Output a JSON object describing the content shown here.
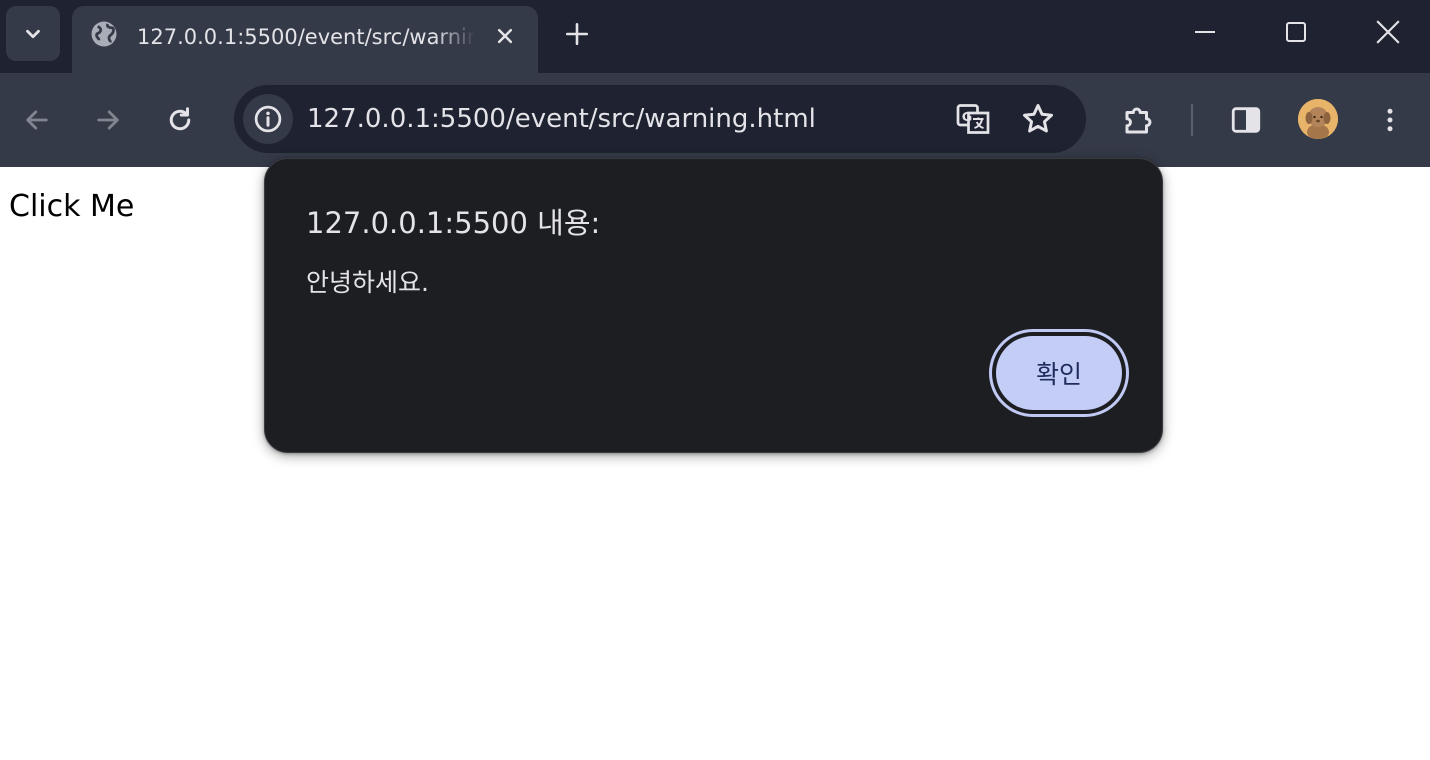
{
  "browser": {
    "tab": {
      "title": "127.0.0.1:5500/event/src/warning.html"
    },
    "address_bar": {
      "url": "127.0.0.1:5500/event/src/warning.html"
    },
    "colors": {
      "tabstrip": "#1f2230",
      "toolbar": "#353a48",
      "accent": "#c4cdf6"
    }
  },
  "page": {
    "body_text": "Click Me"
  },
  "dialog": {
    "title": "127.0.0.1:5500 내용:",
    "message": "안녕하세요.",
    "ok_label": "확인"
  }
}
